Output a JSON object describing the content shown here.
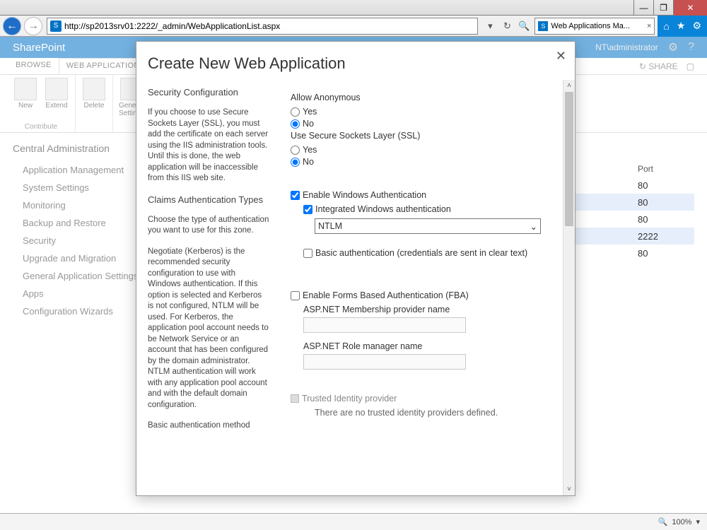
{
  "window": {
    "url": "http://sp2013srv01:2222/_admin/WebApplicationList.aspx",
    "tab_title": "Web Applications Ma..."
  },
  "suite": {
    "brand": "SharePoint",
    "user": "NT\\administrator"
  },
  "ribbon": {
    "tabs": {
      "browse": "BROWSE",
      "webapps": "WEB APPLICATIONS"
    },
    "share": "SHARE",
    "contribute_label": "Contribute",
    "new": "New",
    "extend": "Extend",
    "delete": "Delete",
    "settings": "General\nSettings"
  },
  "leftnav": {
    "header": "Central Administration",
    "items": [
      "Application Management",
      "System Settings",
      "Monitoring",
      "Backup and Restore",
      "Security",
      "Upgrade and Migration",
      "General Application Settings",
      "Apps",
      "Configuration Wizards"
    ]
  },
  "table": {
    "col_port": "Port",
    "rows": [
      {
        "port": "80"
      },
      {
        "port": "80",
        "sel": true
      },
      {
        "port": "80"
      },
      {
        "port": "2222",
        "sel": true
      },
      {
        "port": "80"
      }
    ]
  },
  "modal": {
    "title": "Create New Web Application",
    "sec_config": "Security Configuration",
    "sec_config_text": "If you choose to use Secure Sockets Layer (SSL), you must add the certificate on each server using the IIS administration tools.  Until this is done, the web application will be inaccessible from this IIS web site.",
    "claims_title": "Claims Authentication Types",
    "claims_text1": "Choose the type of authentication you want to use for this zone.",
    "claims_text2": "Negotiate (Kerberos) is the recommended security configuration to use with Windows authentication. If this option is selected and Kerberos is not configured, NTLM will be used. For Kerberos, the application pool account needs to be Network Service or an account that has been configured by the domain administrator. NTLM authentication will work with any application pool account and with the default domain configuration.",
    "claims_text3": "Basic authentication method",
    "allow_anon": "Allow Anonymous",
    "yes": "Yes",
    "no": "No",
    "use_ssl": "Use Secure Sockets Layer (SSL)",
    "enable_win": "Enable Windows Authentication",
    "integrated": "Integrated Windows authentication",
    "ntlm": "NTLM",
    "basic_auth": "Basic authentication (credentials are sent in clear text)",
    "enable_fba": "Enable Forms Based Authentication (FBA)",
    "membership": "ASP.NET Membership provider name",
    "role_mgr": "ASP.NET Role manager name",
    "trusted": "Trusted Identity provider",
    "no_trusted": "There are no trusted identity providers defined."
  },
  "status": {
    "zoom": "100%"
  }
}
